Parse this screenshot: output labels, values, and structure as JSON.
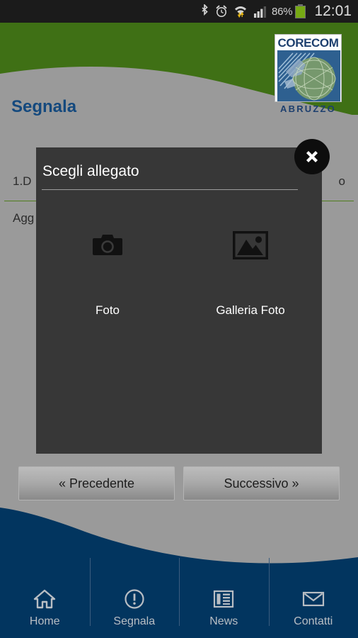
{
  "statusbar": {
    "icons": [
      "bluetooth-icon",
      "alarm-icon",
      "wifi-icon",
      "signal-icon"
    ],
    "battery_percent": "86%",
    "battery_icon": "battery-icon",
    "time": "12:01"
  },
  "header": {
    "logo_title": "CORECOM",
    "logo_subtitle": "ABRUZZO",
    "background_color": "#3f7015"
  },
  "page": {
    "title": "Segnala",
    "title_color": "#14497e",
    "field_label_left": "1.D",
    "field_label_right": "o",
    "field_label_below": "Agg"
  },
  "nav_buttons": {
    "previous": "« Precedente",
    "next": "Successivo »"
  },
  "dialog": {
    "title": "Scegli allegato",
    "close_icon": "close-icon",
    "options": [
      {
        "label": "Foto",
        "icon": "camera-icon"
      },
      {
        "label": "Galleria Foto",
        "icon": "image-gallery-icon"
      }
    ],
    "background_color": "#373737"
  },
  "tabbar": {
    "background_color": "#02355f",
    "items": [
      {
        "label": "Home",
        "icon": "home-icon"
      },
      {
        "label": "Segnala",
        "icon": "exclamation-circle-icon"
      },
      {
        "label": "News",
        "icon": "newspaper-icon"
      },
      {
        "label": "Contatti",
        "icon": "envelope-icon"
      }
    ]
  }
}
